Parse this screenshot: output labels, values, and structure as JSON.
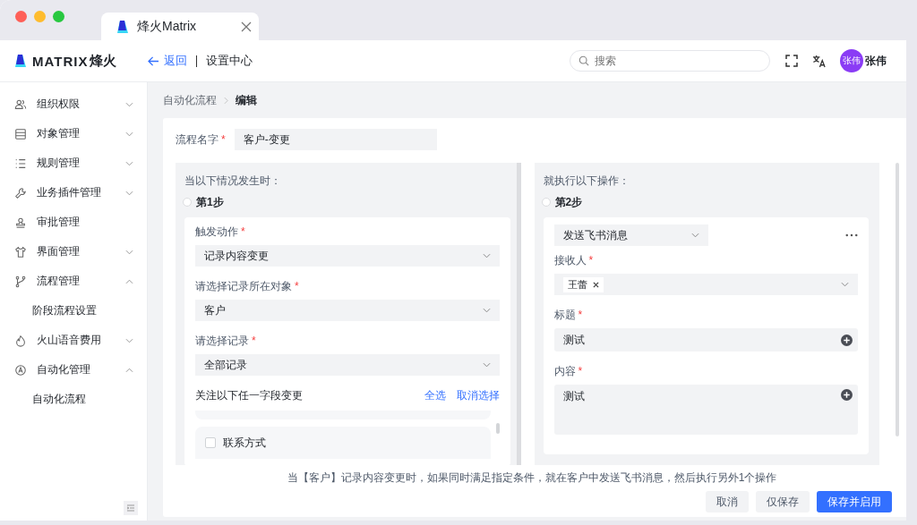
{
  "browser_tab": {
    "title": "烽火Matrix"
  },
  "header": {
    "logo_word": "MATRIX",
    "logo_suffix": "烽火",
    "back": "返回",
    "section": "设置中心",
    "search": {
      "placeholder": "搜索"
    },
    "user": {
      "avatar": "张伟",
      "name": "张伟"
    }
  },
  "sidebar": {
    "items": [
      {
        "label": "组织权限",
        "kind": "group",
        "expanded": false
      },
      {
        "label": "对象管理",
        "kind": "group",
        "expanded": false
      },
      {
        "label": "规则管理",
        "kind": "group",
        "expanded": false
      },
      {
        "label": "业务插件管理",
        "kind": "group",
        "expanded": false
      },
      {
        "label": "审批管理",
        "kind": "link"
      },
      {
        "label": "界面管理",
        "kind": "group",
        "expanded": false
      },
      {
        "label": "流程管理",
        "kind": "group",
        "expanded": true,
        "children": [
          {
            "label": "阶段流程设置"
          }
        ]
      },
      {
        "label": "火山语音费用",
        "kind": "group",
        "expanded": false
      },
      {
        "label": "自动化管理",
        "kind": "group",
        "expanded": true,
        "children": [
          {
            "label": "自动化流程"
          }
        ]
      }
    ]
  },
  "breadcrumb": [
    "自动化流程",
    "编辑"
  ],
  "flow_name": {
    "label": "流程名字",
    "mark": "*",
    "value": "客户-变更"
  },
  "trigger": {
    "heading": "当以下情况发生时：",
    "step": "第1步",
    "fields": [
      {
        "label": "触发动作",
        "mark": "*",
        "value": "记录内容变更"
      },
      {
        "label": "请选择记录所在对象",
        "mark": "*",
        "value": "客户"
      },
      {
        "label": "请选择记录",
        "mark": "*",
        "value": "全部记录"
      }
    ],
    "watch": {
      "label": "关注以下任一字段变更",
      "select_all": "全选",
      "clear": "取消选择",
      "options": [
        {
          "label": "联系方式",
          "checked": false
        }
      ]
    }
  },
  "action": {
    "heading": "就执行以下操作：",
    "step": "第2步",
    "type": "发送飞书消息",
    "recipients": {
      "label": "接收人",
      "mark": "*",
      "tags": [
        "王蕾"
      ]
    },
    "title_field": {
      "label": "标题",
      "mark": "*",
      "value": "测试"
    },
    "content_field": {
      "label": "内容",
      "mark": "*",
      "value": "测试"
    }
  },
  "summary": "当【客户】记录内容变更时，如果同时满足指定条件，就在客户中发送飞书消息，然后执行另外1个操作",
  "buttons": [
    {
      "label": "取消",
      "kind": "secondary"
    },
    {
      "label": "仅保存",
      "kind": "secondary"
    },
    {
      "label": "保存并启用",
      "kind": "primary"
    }
  ]
}
